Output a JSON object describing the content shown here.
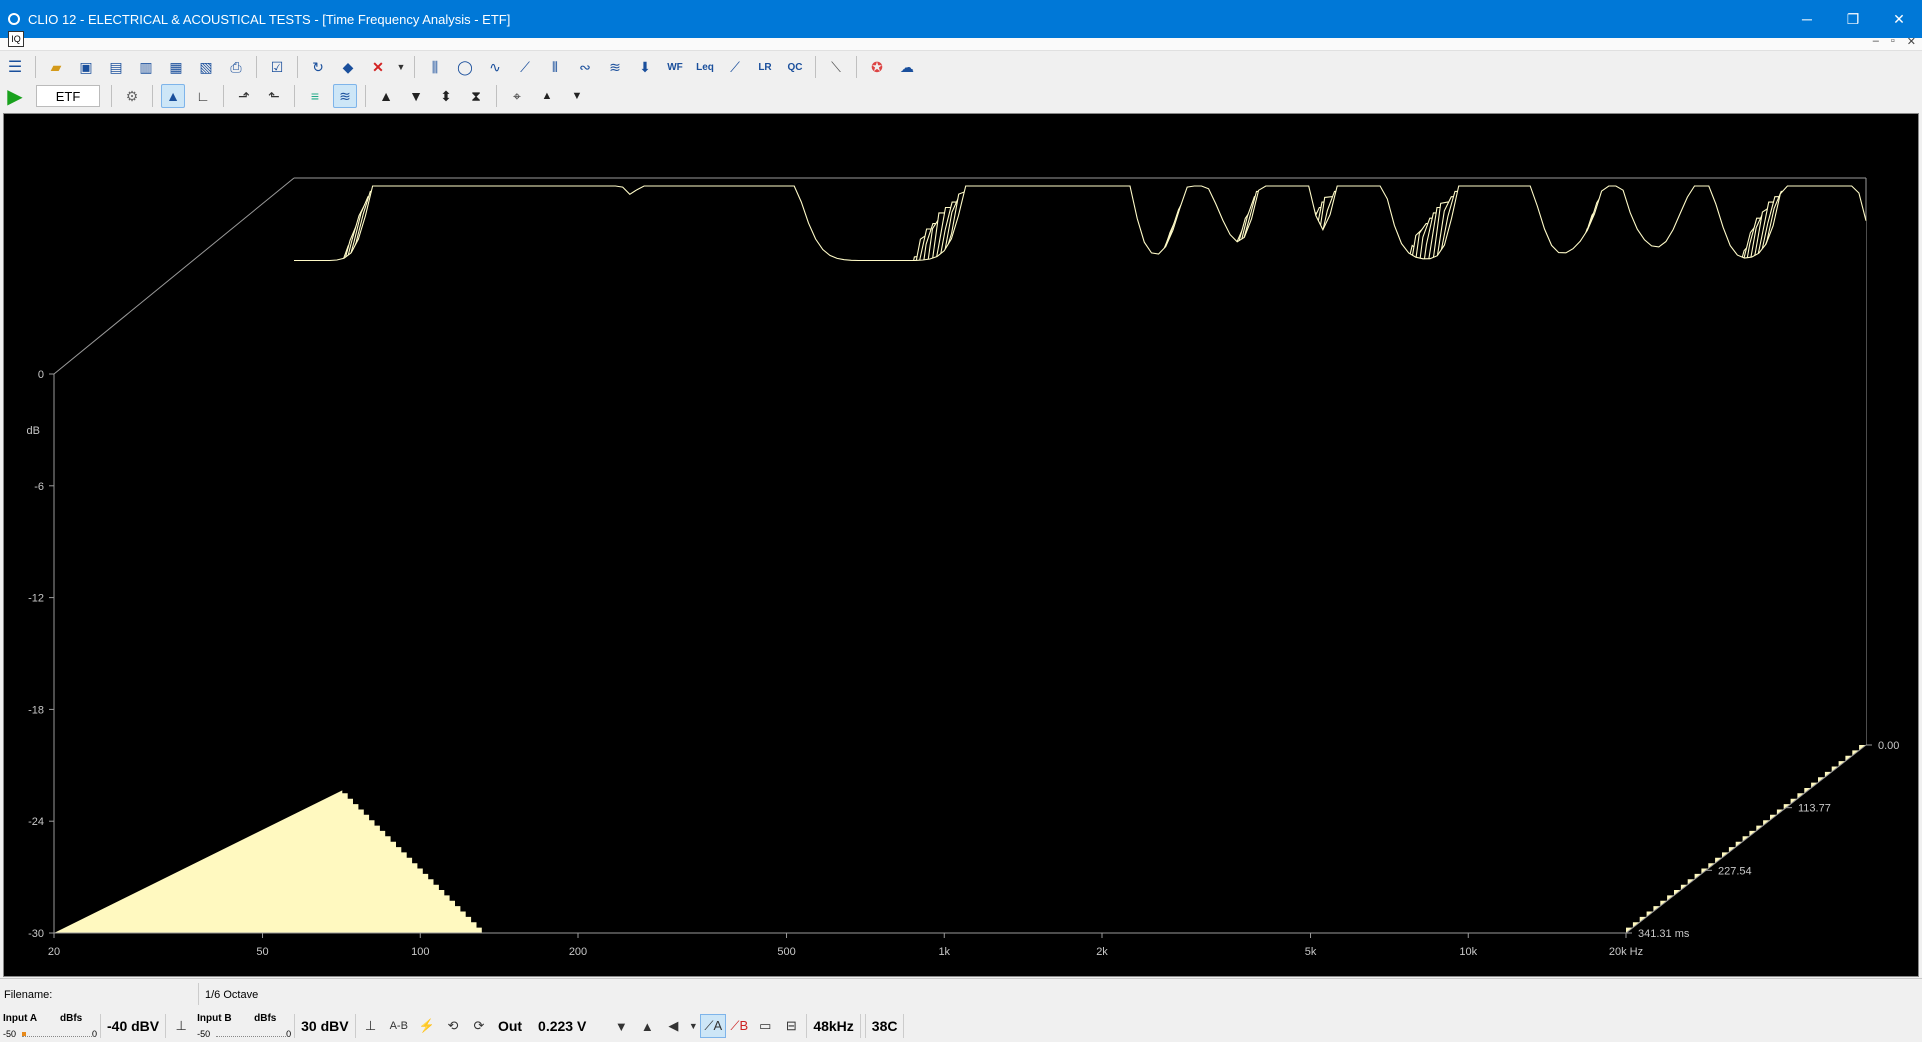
{
  "window": {
    "title": "CLIO 12 - ELECTRICAL & ACOUSTICAL TESTS - [Time Frequency Analysis - ETF]"
  },
  "window_controls": {
    "minimize": "─",
    "restore": "❐",
    "close": "✕"
  },
  "mdi": {
    "icon_text": "IQ",
    "controls": [
      "–",
      "▫",
      "✕"
    ]
  },
  "toolbar2": {
    "mode": "ETF"
  },
  "chart_data": {
    "type": "waterfall",
    "y_axis": {
      "unit": "dB",
      "ticks": [
        "0",
        "-6",
        "-12",
        "-18",
        "-24",
        "-30"
      ],
      "range": [
        -30,
        0
      ]
    },
    "x_axis": {
      "ticks": [
        "20",
        "50",
        "100",
        "200",
        "500",
        "1k",
        "2k",
        "5k",
        "10k",
        "20k Hz"
      ],
      "range_hz": [
        20,
        20000
      ],
      "scale": "log"
    },
    "z_axis": {
      "ticks": [
        "0.00",
        "113.77",
        "227.54",
        "341.31 ms"
      ],
      "range_ms": [
        0,
        341.31
      ]
    },
    "colors": {
      "background": "#000000",
      "trace": "#fffbc8",
      "fill": "#fff9c0",
      "axes": "#9a9a9a",
      "labels": "#c8c8c8"
    }
  },
  "status": {
    "filename_label": "Filename:",
    "resolution": "1/6 Octave",
    "input_a": {
      "label": "Input A",
      "unit": "dBfs",
      "scale_min": "-50",
      "scale_max": "0",
      "level_fraction": 0.05,
      "range": "-40 dBV"
    },
    "input_b": {
      "label": "Input B",
      "unit": "dBfs",
      "scale_min": "-50",
      "scale_max": "0",
      "level_fraction": 0.0,
      "range": "30 dBV"
    },
    "a_minus_b": "A-B",
    "out_label": "Out",
    "out_value": "0.223 V",
    "sample_rate": "48kHz",
    "temperature": "38C"
  }
}
